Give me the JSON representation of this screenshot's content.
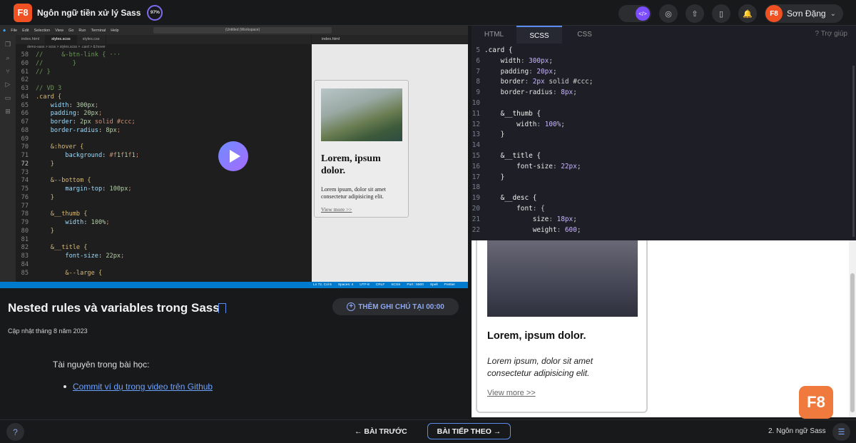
{
  "header": {
    "logo": "F8",
    "course_title": "Ngôn ngữ tiền xử lý Sass",
    "progress": "97%",
    "user_avatar": "F8",
    "user_name": "Sơn Đặng"
  },
  "vscode": {
    "menu": [
      "File",
      "Edit",
      "Selection",
      "View",
      "Go",
      "Run",
      "Terminal",
      "Help"
    ],
    "search": "(Untitled (Workspace)",
    "tabs": [
      "index.html",
      "styles.scss",
      "styles.css"
    ],
    "preview_tab": "index.html",
    "breadcrumb": "demo-sass > scss > styles.scss > .card > &:hover",
    "status": [
      "Ln 72, Col 6",
      "Spaces: 4",
      "UTF-8",
      "CRLF",
      "SCSS",
      "Port : 5500",
      "Spell",
      "Prettier"
    ]
  },
  "vscode_code": [
    {
      "ln": "58",
      "t": "// ",
      "b": "    &-btn-link { ···"
    },
    {
      "ln": "60",
      "t": "//",
      "b": "        }"
    },
    {
      "ln": "61",
      "t": "// }",
      "b": ""
    },
    {
      "ln": "62",
      "t": "",
      "b": ""
    },
    {
      "ln": "63",
      "t": "// VD 3",
      "b": ""
    },
    {
      "ln": "64",
      "t": ".card {",
      "b": ""
    },
    {
      "ln": "65",
      "t": "    width: 300px;",
      "b": ""
    },
    {
      "ln": "66",
      "t": "    padding: 20px;",
      "b": ""
    },
    {
      "ln": "67",
      "t": "    border: 2px solid #ccc;",
      "b": ""
    },
    {
      "ln": "68",
      "t": "    border-radius: 8px;",
      "b": ""
    },
    {
      "ln": "69",
      "t": "",
      "b": ""
    },
    {
      "ln": "70",
      "t": "    &:hover {",
      "b": ""
    },
    {
      "ln": "71",
      "t": "        background: #f1f1f1;",
      "b": ""
    },
    {
      "ln": "72",
      "t": "    }",
      "b": ""
    },
    {
      "ln": "73",
      "t": "",
      "b": ""
    },
    {
      "ln": "74",
      "t": "    &--bottom {",
      "b": ""
    },
    {
      "ln": "75",
      "t": "        margin-top: 100px;",
      "b": ""
    },
    {
      "ln": "76",
      "t": "    }",
      "b": ""
    },
    {
      "ln": "77",
      "t": "",
      "b": ""
    },
    {
      "ln": "78",
      "t": "    &__thumb {",
      "b": ""
    },
    {
      "ln": "79",
      "t": "        width: 100%;",
      "b": ""
    },
    {
      "ln": "80",
      "t": "    }",
      "b": ""
    },
    {
      "ln": "81",
      "t": "",
      "b": ""
    },
    {
      "ln": "82",
      "t": "    &__title {",
      "b": ""
    },
    {
      "ln": "83",
      "t": "        font-size: 22px;",
      "b": ""
    },
    {
      "ln": "84",
      "t": "",
      "b": ""
    },
    {
      "ln": "85",
      "t": "        &--large {",
      "b": ""
    }
  ],
  "mini_card": {
    "title": "Lorem, ipsum dolor.",
    "desc": "Lorem ipsum, dolor sit amet consectetur adipisicing elit.",
    "more": "View more >>"
  },
  "lesson": {
    "title": "Nested rules và variables trong Sass",
    "updated": "Cập nhật tháng 8 năm 2023",
    "note_button": "THÊM GHI CHÚ TẠI 00:00",
    "resources_label": "Tài nguyên trong bài học:",
    "resource_link": "Commit ví dụ trong video trên Github"
  },
  "editor": {
    "tabs": [
      "HTML",
      "SCSS",
      "CSS"
    ],
    "help": "Trợ giúp"
  },
  "editor_code": [
    {
      "ln": "5",
      "t": ".card {"
    },
    {
      "ln": "6",
      "t": "    width: 300px;"
    },
    {
      "ln": "7",
      "t": "    padding: 20px;"
    },
    {
      "ln": "8",
      "t": "    border: 2px solid #ccc;"
    },
    {
      "ln": "9",
      "t": "    border-radius: 8px;"
    },
    {
      "ln": "10",
      "t": ""
    },
    {
      "ln": "11",
      "t": "    &__thumb {"
    },
    {
      "ln": "12",
      "t": "        width: 100%;"
    },
    {
      "ln": "13",
      "t": "    }"
    },
    {
      "ln": "14",
      "t": ""
    },
    {
      "ln": "15",
      "t": "    &__title {"
    },
    {
      "ln": "16",
      "t": "        font-size: 22px;"
    },
    {
      "ln": "17",
      "t": "    }"
    },
    {
      "ln": "18",
      "t": ""
    },
    {
      "ln": "19",
      "t": "    &__desc {"
    },
    {
      "ln": "20",
      "t": "        font: {"
    },
    {
      "ln": "21",
      "t": "            size: 18px;"
    },
    {
      "ln": "22",
      "t": "            weight: 600;"
    }
  ],
  "result_card": {
    "title": "Lorem, ipsum dolor.",
    "desc": "Lorem ipsum, dolor sit amet consectetur adipisicing elit.",
    "more": "View more >>"
  },
  "footer": {
    "prev": "← BÀI TRƯỚC",
    "next": "BÀI TIẾP THEO →",
    "chapter": "2. Ngôn ngữ Sass",
    "f8": "F8"
  },
  "colors": {
    "brand": "#f05123",
    "accent": "#5a8dee",
    "vscode_status": "#007acc"
  }
}
